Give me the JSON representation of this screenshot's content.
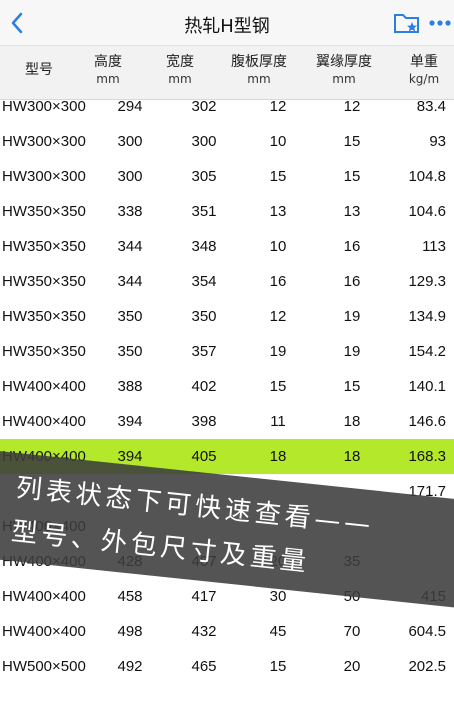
{
  "nav": {
    "title": "热轧H型钢",
    "back_icon": "chevron-left-icon",
    "folder_icon": "folder-star-icon",
    "more_icon": "more-dots-icon",
    "accent": "#2a7fe6"
  },
  "columns": [
    {
      "label": "型号",
      "unit": ""
    },
    {
      "label": "高度",
      "unit": "mm"
    },
    {
      "label": "宽度",
      "unit": "mm"
    },
    {
      "label": "腹板厚度",
      "unit": "mm"
    },
    {
      "label": "翼缘厚度",
      "unit": "mm"
    },
    {
      "label": "单重",
      "unit": "kg/m"
    }
  ],
  "rows": [
    [
      "HW300×300",
      "294",
      "302",
      "12",
      "12",
      "83.4"
    ],
    [
      "HW300×300",
      "300",
      "300",
      "10",
      "15",
      "93"
    ],
    [
      "HW300×300",
      "300",
      "305",
      "15",
      "15",
      "104.8"
    ],
    [
      "HW350×350",
      "338",
      "351",
      "13",
      "13",
      "104.6"
    ],
    [
      "HW350×350",
      "344",
      "348",
      "10",
      "16",
      "113"
    ],
    [
      "HW350×350",
      "344",
      "354",
      "16",
      "16",
      "129.3"
    ],
    [
      "HW350×350",
      "350",
      "350",
      "12",
      "19",
      "134.9"
    ],
    [
      "HW350×350",
      "350",
      "357",
      "19",
      "19",
      "154.2"
    ],
    [
      "HW400×400",
      "388",
      "402",
      "15",
      "15",
      "140.1"
    ],
    [
      "HW400×400",
      "394",
      "398",
      "11",
      "18",
      "146.6"
    ],
    [
      "HW400×400",
      "394",
      "405",
      "18",
      "18",
      "168.3"
    ],
    [
      "",
      "",
      "",
      "",
      "",
      "171.7"
    ],
    [
      "HW400×400",
      "",
      "",
      "",
      "",
      ""
    ],
    [
      "HW400×400",
      "428",
      "407",
      "20",
      "35",
      ""
    ],
    [
      "HW400×400",
      "458",
      "417",
      "30",
      "50",
      "415"
    ],
    [
      "HW400×400",
      "498",
      "432",
      "45",
      "70",
      "604.5"
    ],
    [
      "HW500×500",
      "492",
      "465",
      "15",
      "20",
      "202.5"
    ]
  ],
  "highlight_row": 10,
  "highlight_color": "#b4e82b",
  "overlay": {
    "line1": "列表状态下可快速查看——",
    "line2": "型号、外包尺寸及重量"
  }
}
